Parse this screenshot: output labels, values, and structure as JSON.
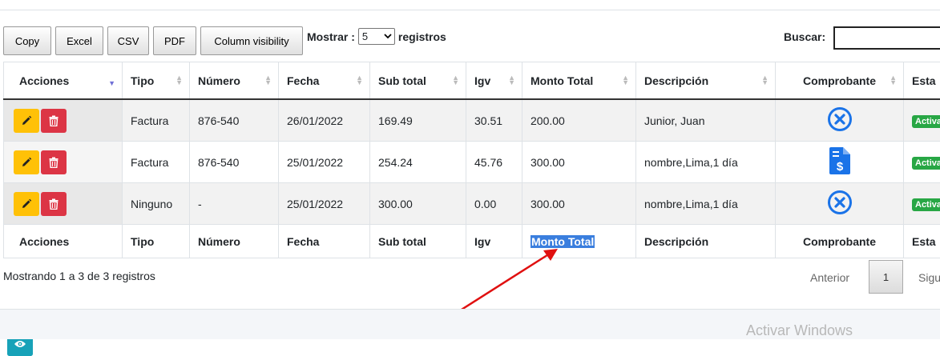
{
  "toolbar": {
    "buttons": [
      "Copy",
      "Excel",
      "CSV",
      "PDF",
      "Column visibility"
    ],
    "show_prefix": "Mostrar :",
    "show_value": "5",
    "show_suffix": "registros",
    "search_label": "Buscar:",
    "search_value": ""
  },
  "table": {
    "headers": [
      "Acciones",
      "Tipo",
      "Número",
      "Fecha",
      "Sub total",
      "Igv",
      "Monto Total",
      "Descripción",
      "Comprobante",
      "Estado"
    ],
    "header_visible": [
      "Acciones",
      "Tipo",
      "Número",
      "Fecha",
      "Sub total",
      "Igv",
      "Monto Total",
      "Descripción",
      "Comprobante",
      "Esta"
    ],
    "rows": [
      {
        "tipo": "Factura",
        "numero": "876-540",
        "fecha": "26/01/2022",
        "subtotal": "169.49",
        "igv": "30.51",
        "monto": "200.00",
        "descripcion": "Junior, Juan",
        "comprobante_icon": "x-circle-icon",
        "estado": "Activa"
      },
      {
        "tipo": "Factura",
        "numero": "876-540",
        "fecha": "25/01/2022",
        "subtotal": "254.24",
        "igv": "45.76",
        "monto": "300.00",
        "descripcion": "nombre,Lima,1 día",
        "comprobante_icon": "invoice-dollar-icon",
        "estado": "Activa"
      },
      {
        "tipo": "Ninguno",
        "numero": "-",
        "fecha": "25/01/2022",
        "subtotal": "300.00",
        "igv": "0.00",
        "monto": "300.00",
        "descripcion": "nombre,Lima,1 día",
        "comprobante_icon": "x-circle-icon",
        "estado": "Activa"
      }
    ],
    "footer_highlighted": "Monto Total"
  },
  "info_text": "Mostrando 1 a 3 de 3 registros",
  "pagination": {
    "prev": "Anterior",
    "page": "1",
    "next": "Siguiente"
  },
  "watermark": "Activar Windows",
  "colors": {
    "edit": "#ffc107",
    "delete": "#dc3545",
    "view": "#17a2b8",
    "badge": "#28a745",
    "highlight": "#3a7ede",
    "arrow": "#e01010",
    "icon_blue": "#1a73e8"
  }
}
